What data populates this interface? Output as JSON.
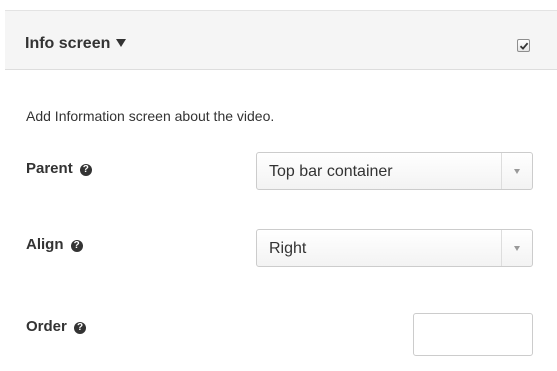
{
  "header": {
    "title": "Info screen",
    "toggle_icon": "caret-down-icon",
    "enabled": true
  },
  "description": "Add Information screen about the video.",
  "fields": {
    "parent": {
      "label": "Parent",
      "help_icon": "question-circle-icon",
      "selected": "Top bar container"
    },
    "align": {
      "label": "Align",
      "help_icon": "question-circle-icon",
      "selected": "Right"
    },
    "order": {
      "label": "Order",
      "help_icon": "question-circle-icon",
      "value": ""
    }
  },
  "icons": {
    "help_glyph": "?"
  },
  "colors": {
    "header_bg": "#f5f5f5",
    "text": "#333333",
    "border": "#cccccc"
  }
}
